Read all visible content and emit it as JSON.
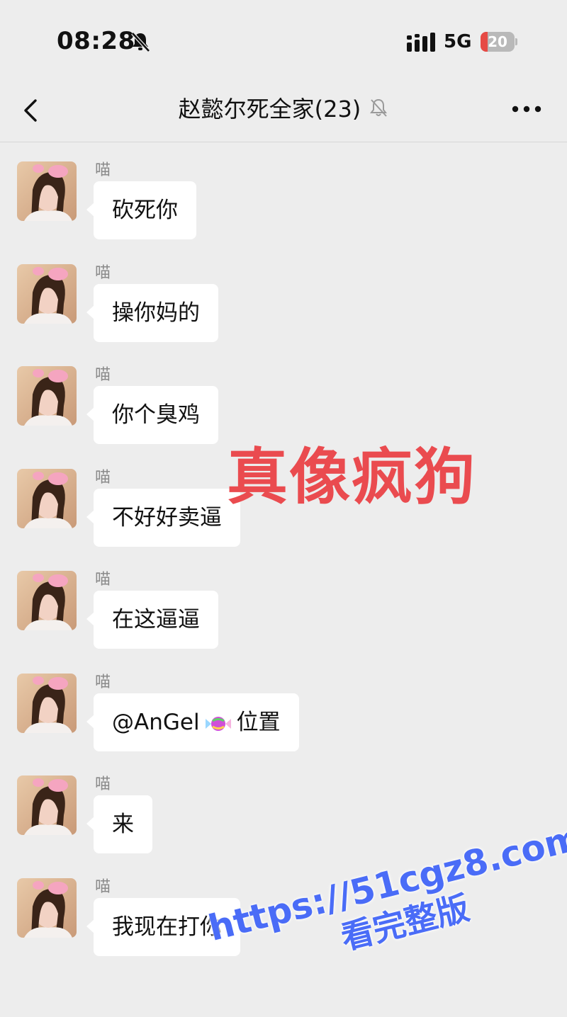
{
  "status_bar": {
    "time": "08:28",
    "network": "5G",
    "battery_level": "20",
    "battery_fraction": 0.2,
    "icons": [
      "bell-off-icon",
      "signal-icon",
      "battery-icon"
    ]
  },
  "nav": {
    "title": "赵懿尔死全家(23)",
    "icons": [
      "back-chevron-icon",
      "bell-off-icon",
      "more-dots-icon"
    ]
  },
  "messages": [
    {
      "sender": "喵",
      "text": "砍死你"
    },
    {
      "sender": "喵",
      "text": "操你妈的"
    },
    {
      "sender": "喵",
      "text": "你个臭鸡"
    },
    {
      "sender": "喵",
      "text": "不好好卖逼"
    },
    {
      "sender": "喵",
      "text": "在这逼逼"
    },
    {
      "sender": "喵",
      "text_before": "@AnGel",
      "text_emoji": "candy-icon",
      "text_after": "位置"
    },
    {
      "sender": "喵",
      "text": "来"
    },
    {
      "sender": "喵",
      "text": "我现在打你"
    }
  ],
  "overlay": {
    "caption": "真像疯狗",
    "caption_color": "#ea4b4f",
    "watermark_url": "https://51cgz8.com",
    "watermark_sub": "看完整版",
    "watermark_color": "#4a6cf7"
  },
  "colors": {
    "background": "#ededed",
    "bubble": "#ffffff",
    "sender_name": "#8a8a8a",
    "battery_low": "#e64a45"
  }
}
